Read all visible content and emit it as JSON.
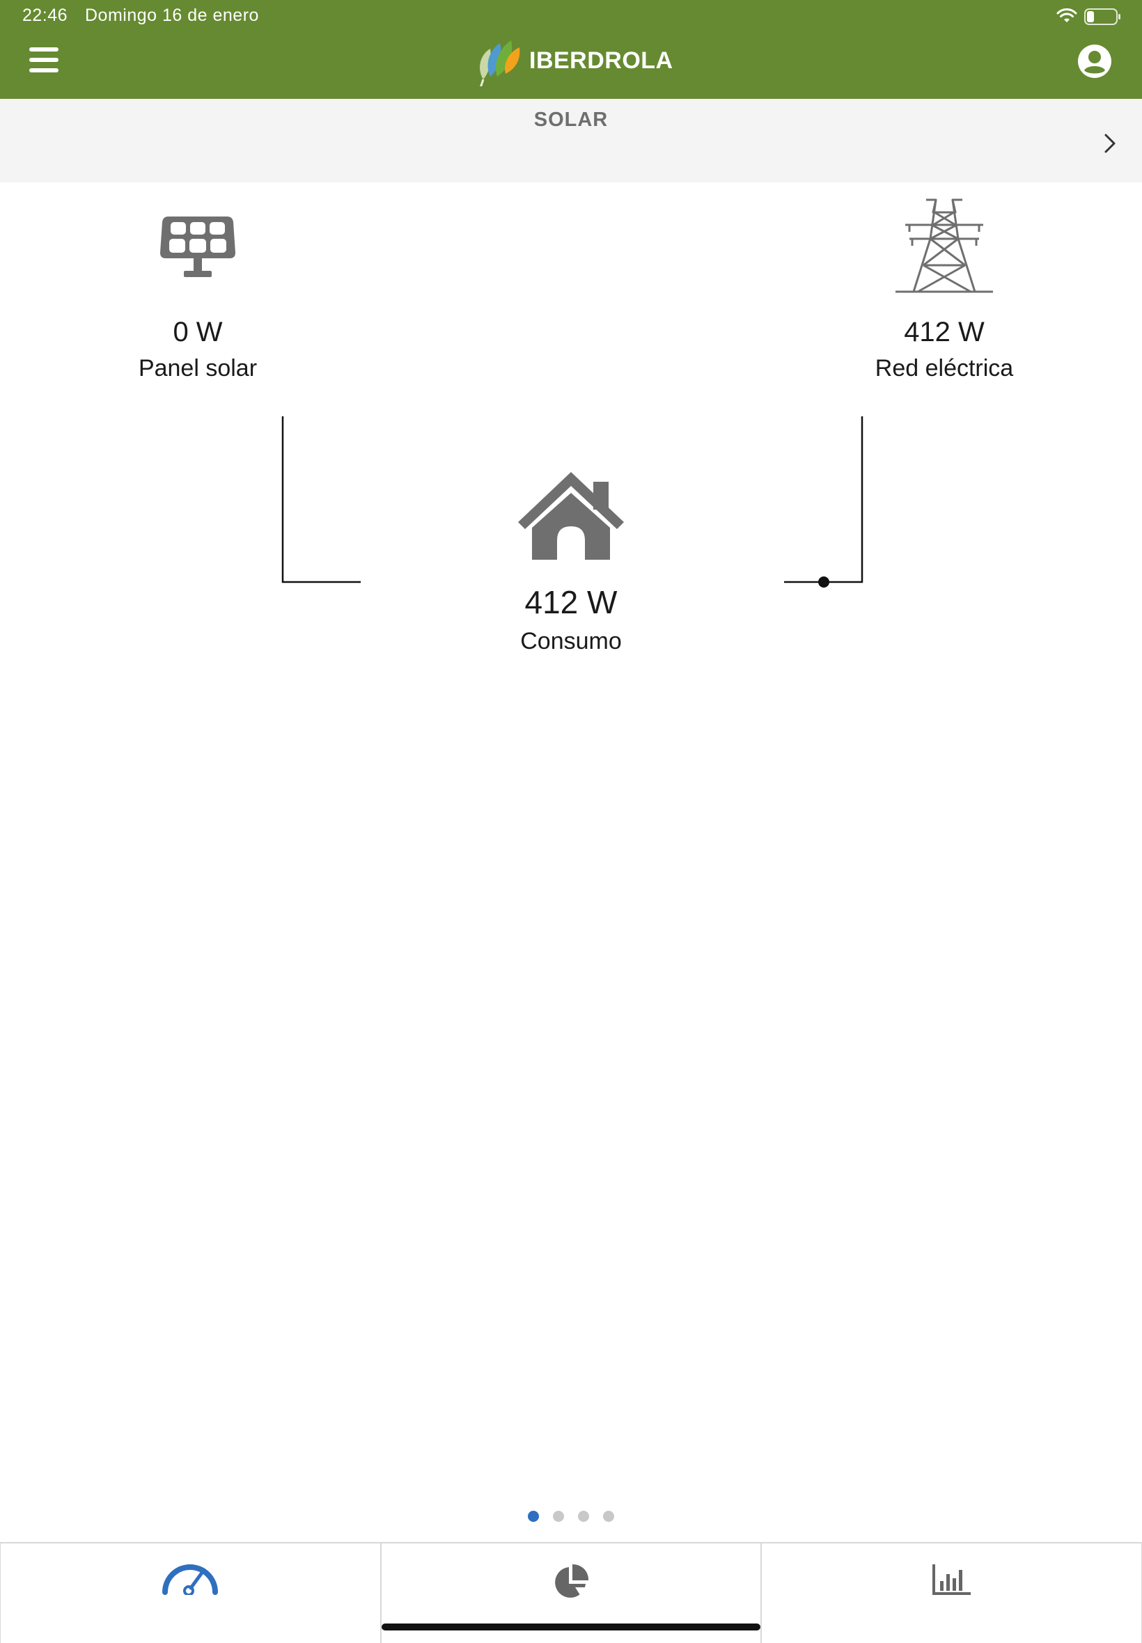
{
  "status_bar": {
    "time": "22:46",
    "date": "Domingo 16 de enero",
    "icons": [
      "wifi-icon",
      "battery-icon"
    ]
  },
  "header": {
    "menu_icon": "hamburger-menu-icon",
    "logo_text": "IBERDROLA",
    "profile_icon": "user-icon",
    "background_color": "#668a31"
  },
  "section": {
    "title": "SOLAR",
    "next_icon": "chevron-right-icon"
  },
  "flow": {
    "solar": {
      "value": "0 W",
      "label": "Panel solar",
      "icon": "solar-panel-icon"
    },
    "grid": {
      "value": "412 W",
      "label": "Red eléctrica",
      "icon": "power-tower-icon"
    },
    "consumption": {
      "value": "412 W",
      "label": "Consumo",
      "icon": "house-icon"
    }
  },
  "pager": {
    "pages": 4,
    "active": 1,
    "active_color": "#2f6fbf"
  },
  "tabs": [
    {
      "icon": "gauge-icon",
      "active": true,
      "color": "#2f6fbf"
    },
    {
      "icon": "pie-chart-icon",
      "active": false,
      "color": "#666666"
    },
    {
      "icon": "bar-chart-icon",
      "active": false,
      "color": "#666666"
    }
  ]
}
